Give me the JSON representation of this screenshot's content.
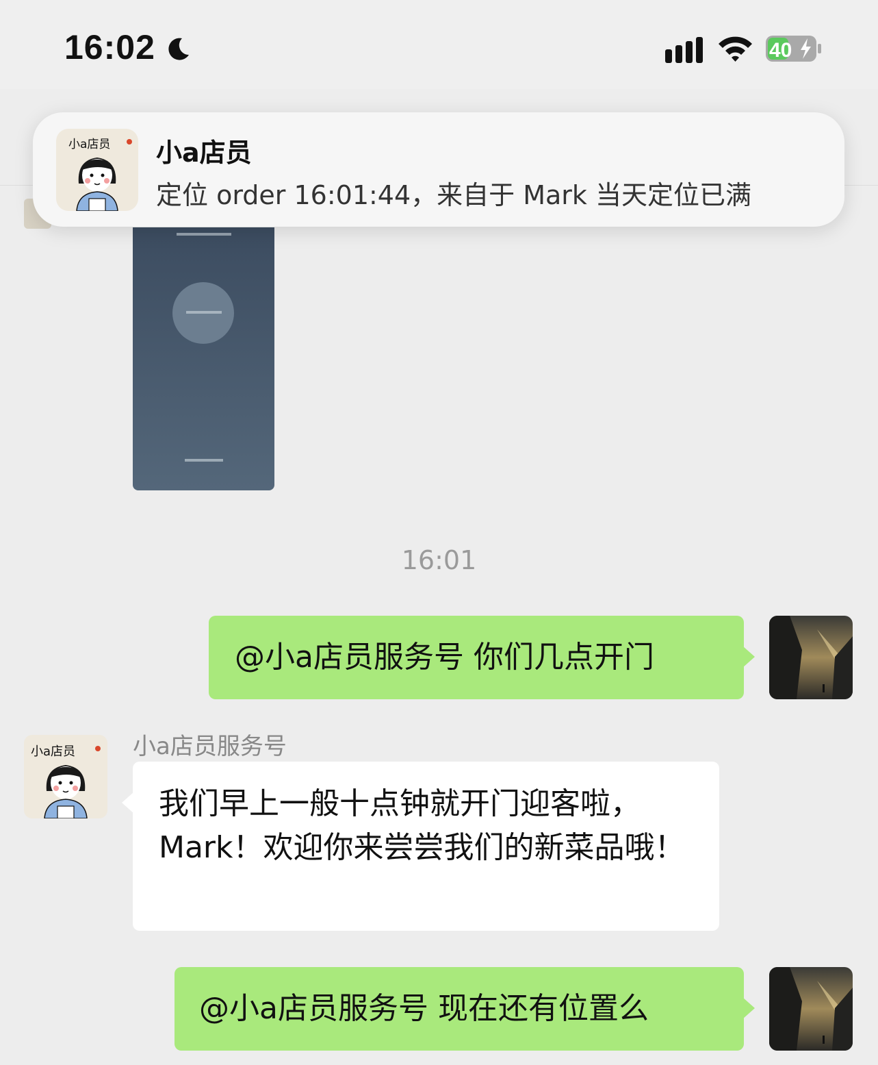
{
  "status_bar": {
    "time": "16:02",
    "battery_level": "40",
    "icons": [
      "moon-icon",
      "cellular-signal-icon",
      "wifi-icon",
      "battery-charging-icon"
    ]
  },
  "notification": {
    "title": "小a店员",
    "body": "定位 order 16:01:44，来自于 Mark 当天定位已满",
    "icon_caption": "小a店员"
  },
  "chat": {
    "timestamp": "16:01",
    "messages": [
      {
        "from": "me",
        "text": "@小a店员服务号 你们几点开门"
      },
      {
        "from": "bot",
        "sender": "小a店员服务号",
        "text": "我们早上一般十点钟就开门迎客啦，Mark！欢迎你来尝尝我们的新菜品哦！"
      },
      {
        "from": "me",
        "text": "@小a店员服务号 现在还有位置么"
      }
    ],
    "bot_avatar_caption": "小a店员"
  },
  "colors": {
    "background": "#ededed",
    "my_bubble": "#a9e97c",
    "other_bubble": "#ffffff",
    "battery_green": "#5bc95d"
  }
}
